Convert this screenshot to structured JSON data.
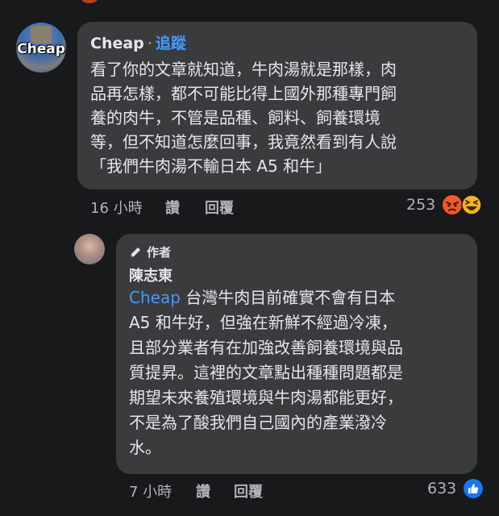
{
  "comment1": {
    "author": "Cheap",
    "separator": "·",
    "follow": "追蹤",
    "avatar_text": "Cheap",
    "lines": [
      "看了你的文章就知道，牛肉湯就是那樣，肉",
      "品再怎樣，都不可能比得上國外那種專門飼",
      "養的肉牛，不管是品種、飼料、飼養環境",
      "等，但不知道怎麼回事，我竟然看到有人說",
      "「我們牛肉湯不輸日本 A5 和牛」"
    ],
    "time": "16 小時",
    "like": "讚",
    "reply": "回覆",
    "reaction_count": "253",
    "reaction_icons": [
      "angry-emoji-icon",
      "haha-emoji-icon"
    ]
  },
  "reply1": {
    "badge": "作者",
    "author": "陳志東",
    "tag": "Cheap",
    "lines": [
      " 台灣牛肉目前確實不會有日本",
      "A5 和牛好，但強在新鮮不經過冷凍，",
      "且部分業者有在加強改善飼養環境與品",
      "質提昇。這裡的文章點出種種問題都是",
      "期望未來養殖環境與牛肉湯都能更好，",
      "不是為了酸我們自己國內的產業潑冷",
      "水。"
    ],
    "time": "7 小時",
    "like": "讚",
    "reply": "回覆",
    "reaction_count": "633",
    "reaction_icons": [
      "like-emoji-icon"
    ]
  },
  "colors": {
    "background": "#18191a",
    "bubble": "#3a3b3c",
    "link": "#4599ff",
    "like_blue": "#1877f2",
    "angry": "#f0592a",
    "haha": "#f7b125"
  }
}
